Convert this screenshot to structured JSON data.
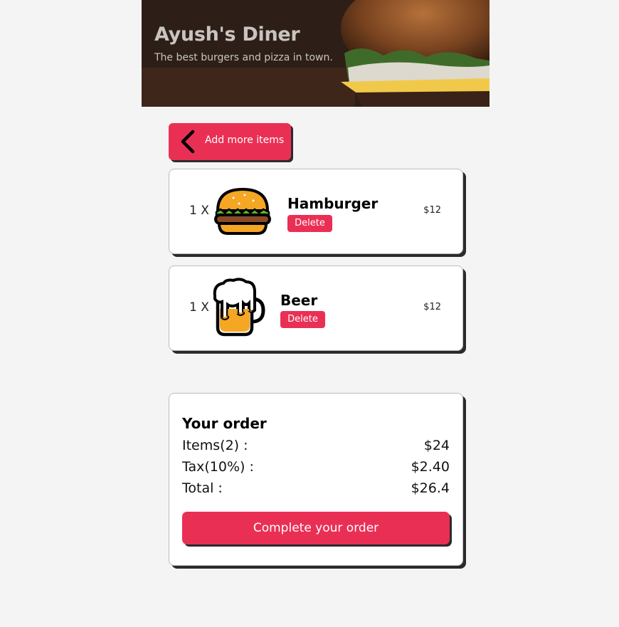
{
  "header": {
    "title": "Ayush's Diner",
    "subtitle": "The best burgers and pizza in town."
  },
  "back_button": {
    "label": "Add more items",
    "icon": "chevron-left-icon"
  },
  "cart": {
    "items": [
      {
        "quantity": "1 X",
        "name": "Hamburger",
        "icon": "hamburger-icon",
        "delete_label": "Delete",
        "price": "$12"
      },
      {
        "quantity": "1 X",
        "name": "Beer",
        "icon": "beer-mug-icon",
        "delete_label": "Delete",
        "price": "$12"
      }
    ]
  },
  "summary": {
    "title": "Your order",
    "items_label": "Items(2) :",
    "items_value": "$24",
    "tax_label": "Tax(10%) :",
    "tax_value": "$2.40",
    "total_label": "Total :",
    "total_value": "$26.4",
    "complete_label": "Complete your order"
  },
  "colors": {
    "accent": "#ea2f55",
    "background": "#f4f4f4",
    "card": "#ffffff",
    "shadow": "#2b2b2b"
  }
}
